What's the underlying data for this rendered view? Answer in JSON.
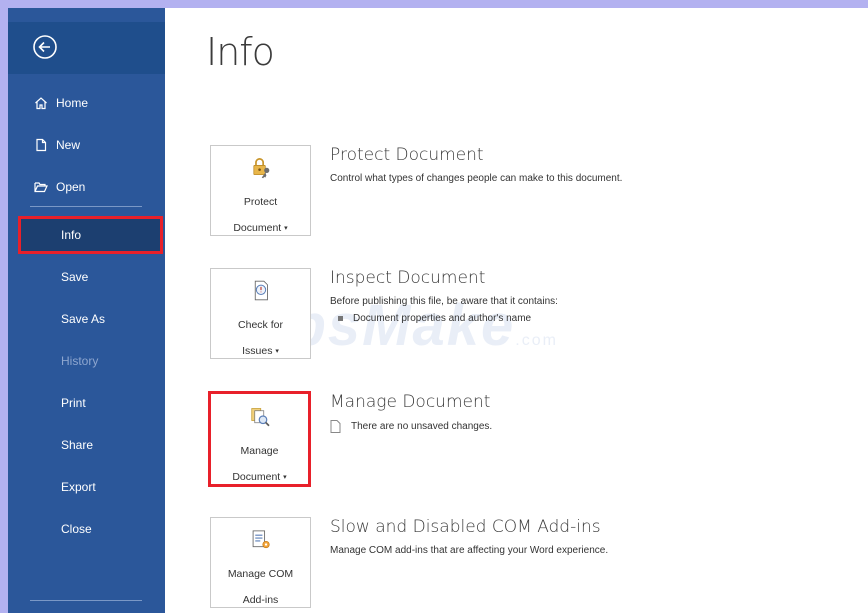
{
  "sidebar": {
    "top_items": [
      {
        "label": "Home",
        "icon": "home-icon"
      },
      {
        "label": "New",
        "icon": "new-document-icon"
      },
      {
        "label": "Open",
        "icon": "open-folder-icon"
      }
    ],
    "main_items": [
      {
        "label": "Info",
        "state": "selected"
      },
      {
        "label": "Save",
        "state": "normal"
      },
      {
        "label": "Save As",
        "state": "normal"
      },
      {
        "label": "History",
        "state": "disabled"
      },
      {
        "label": "Print",
        "state": "normal"
      },
      {
        "label": "Share",
        "state": "normal"
      },
      {
        "label": "Export",
        "state": "normal"
      },
      {
        "label": "Close",
        "state": "normal"
      }
    ]
  },
  "page": {
    "title": "Info"
  },
  "sections": {
    "protect": {
      "button_line1": "Protect",
      "button_line2": "Document",
      "heading": "Protect Document",
      "description": "Control what types of changes people can make to this document."
    },
    "inspect": {
      "button_line1": "Check for",
      "button_line2": "Issues",
      "heading": "Inspect Document",
      "description": "Before publishing this file, be aware that it contains:",
      "bullet": "Document properties and author's name"
    },
    "manage": {
      "button_line1": "Manage",
      "button_line2": "Document",
      "heading": "Manage Document",
      "note": "There are no unsaved changes."
    },
    "addins": {
      "button_line1": "Manage COM",
      "button_line2": "Add-ins",
      "heading": "Slow and Disabled COM Add-ins",
      "description": "Manage COM add-ins that are affecting your Word experience."
    }
  },
  "watermark": {
    "text": "TipsMake",
    "suffix": ".com"
  },
  "colors": {
    "sidebar": "#2b579a",
    "highlight": "#e8202a",
    "frame": "#b3b1f0"
  }
}
